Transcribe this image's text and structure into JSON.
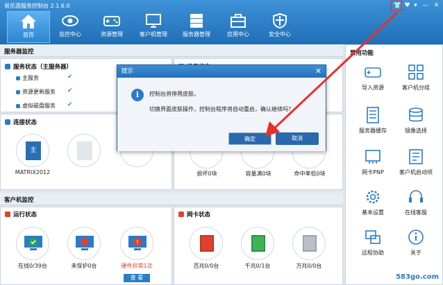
{
  "app": {
    "title": "易乐游服务控制台 2.1.6.0"
  },
  "window": {
    "skin": "👕",
    "menu": "♥",
    "dropdown": "▾",
    "minimize": "—",
    "close": "✕"
  },
  "nav": [
    {
      "label": "首页"
    },
    {
      "label": "监控中心"
    },
    {
      "label": "资源管理"
    },
    {
      "label": "客户机管理"
    },
    {
      "label": "服务器管理"
    },
    {
      "label": "应用中心"
    },
    {
      "label": "安全中心"
    }
  ],
  "server_monitor": {
    "section": "服务器监控",
    "status_title": "服务状态（主服务器）",
    "services": [
      {
        "label": "主服务"
      },
      {
        "label": "资源更新服务"
      },
      {
        "label": "虚拟磁盘服务"
      }
    ],
    "other_panel_title": "优品状态",
    "connect_title": "连接状态",
    "server_name": "主",
    "server_caption": "MATRIX2012"
  },
  "disk_status": {
    "items": [
      {
        "label": "损坏0块"
      },
      {
        "label": "容量满0块"
      },
      {
        "label": "命中率低0块"
      }
    ]
  },
  "client_monitor": {
    "section": "客户机监控",
    "run_title": "运行状态",
    "run_items": [
      {
        "label": "在线0/39台"
      },
      {
        "label": "未保护0台"
      },
      {
        "label": "硬件异常1次"
      }
    ],
    "view_button": "查 看",
    "nic_title": "网卡状态",
    "nic_items": [
      {
        "label": "百兆0/0台"
      },
      {
        "label": "千兆0/1台"
      },
      {
        "label": "万兆0/0台"
      }
    ]
  },
  "common_functions": {
    "title": "常用功能",
    "items": [
      {
        "label": "导入资源"
      },
      {
        "label": "客户机分组"
      },
      {
        "label": "服务器缓存"
      },
      {
        "label": "镜像选择"
      },
      {
        "label": "网卡PNP"
      },
      {
        "label": "客户机启动项"
      },
      {
        "label": "基本设置"
      },
      {
        "label": "在线客服"
      },
      {
        "label": "远程协助"
      },
      {
        "label": "关于"
      }
    ]
  },
  "dialog": {
    "title": "提示",
    "close": "✕",
    "icon": "i",
    "line1": "控制台将停用皮肤。",
    "line2": "切换界面皮肤操作，控制台程序将自动重启，确认继续吗？",
    "ok": "确定",
    "cancel": "取消"
  },
  "watermark": "583go.com",
  "colors": {
    "accent": "#2a7cc7",
    "annotation": "#e8302a",
    "ok_green": "#2aa84a",
    "warn": "#e0412c"
  }
}
